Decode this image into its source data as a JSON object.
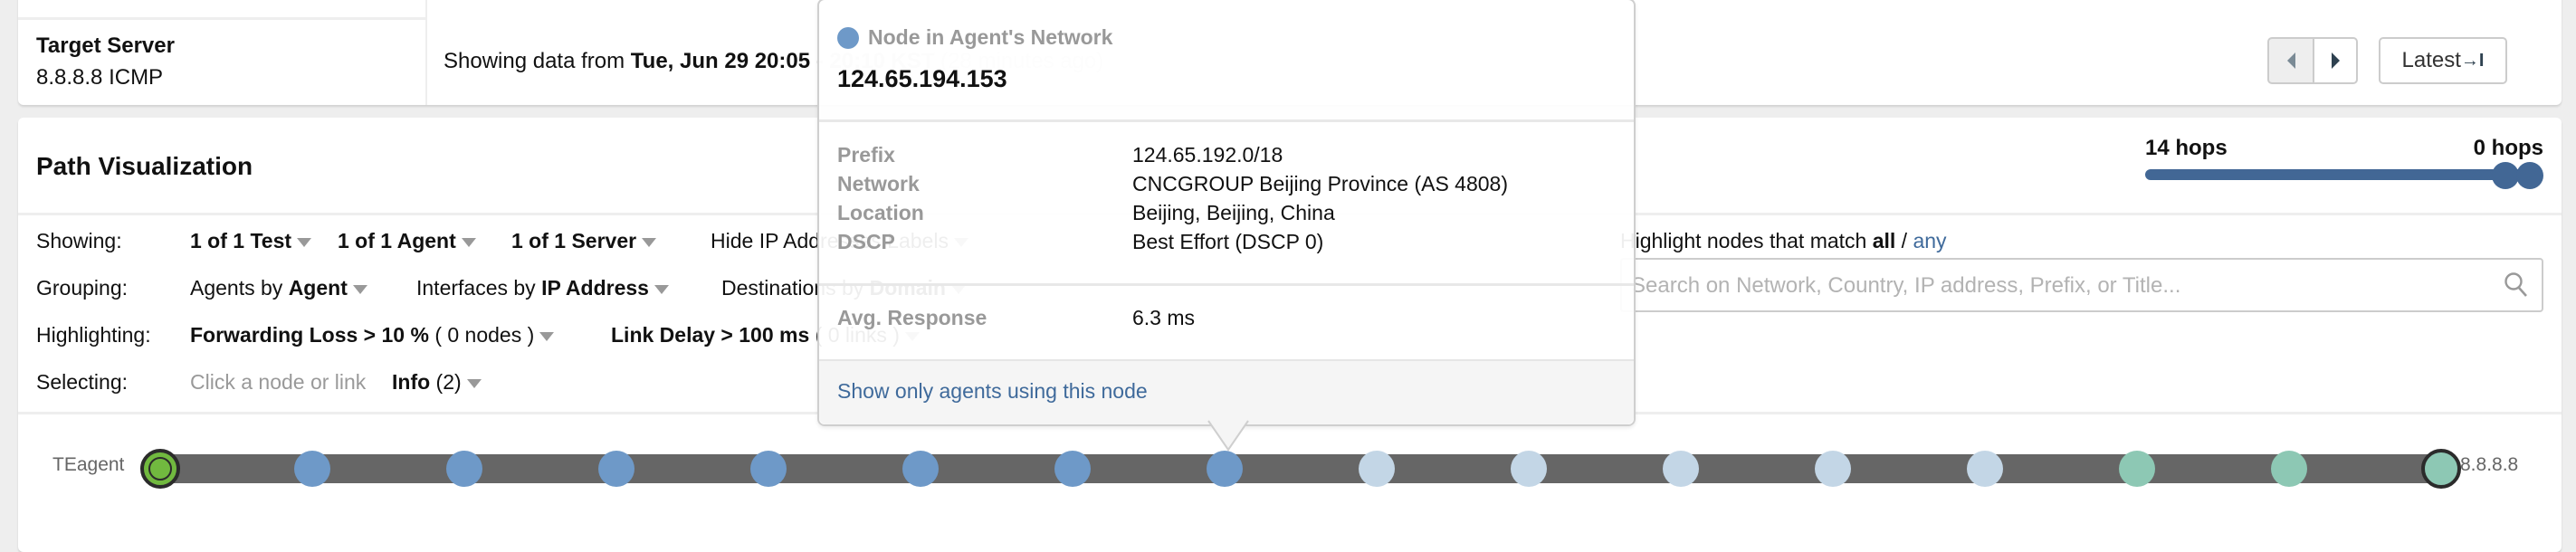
{
  "header": {
    "target_label": "Target Server",
    "target_value": "8.8.8.8 ICMP",
    "time_prefix": "Showing data from ",
    "time_start": "Tue, Jun 29 20:05",
    "time_end": " - 20:10 KST",
    "time_ago": " (28 minutes ago)",
    "prev_icon": "caret-left-icon",
    "next_icon": "caret-right-icon",
    "latest_label": "Latest",
    "latest_icon": "→I"
  },
  "path_viz": {
    "title": "Path Visualization",
    "hops_slider": {
      "left_label": "14 hops",
      "right_label": "0 hops",
      "min_hops": 0,
      "max_hops": 14,
      "range_low": 0,
      "range_high": 0
    },
    "controls": {
      "showing": {
        "label": "Showing:",
        "items": [
          "1 of 1 Test",
          "1 of 1 Agent",
          "1 of 1 Server"
        ],
        "hide_ip_prefix": "Hide IP Addresses",
        "hide_ip_suffix": " Labels"
      },
      "grouping": {
        "label": "Grouping:",
        "agents_pre": "Agents by ",
        "agents_val": "Agent",
        "interfaces_pre": "Interfaces by ",
        "interfaces_val": "IP Address",
        "dest_pre": "Destinations by ",
        "dest_val": "Domain"
      },
      "highlighting": {
        "label": "Highlighting:",
        "loss_val": "Forwarding Loss > 10 %",
        "loss_count": " ( 0 nodes )",
        "delay_val": "Link Delay > 100 ms",
        "delay_count": " ( 0 links )"
      },
      "selecting": {
        "label": "Selecting:",
        "hint": "Click a node or link",
        "info_val": "Info",
        "info_count": " (2)"
      },
      "match": {
        "prefix": "Highlight nodes that match ",
        "all": "all",
        "sep": " / ",
        "any": "any"
      },
      "search_placeholder": "Search on Network, Country, IP address, Prefix, or Title...",
      "search_value": ""
    },
    "path": {
      "source_label": "TEagent",
      "dest_label": "8.8.8.8",
      "nodes": [
        {
          "type": "agent",
          "color": "#71b93f"
        },
        {
          "type": "agent-network",
          "color": "#6e99c8"
        },
        {
          "type": "agent-network",
          "color": "#6e99c8"
        },
        {
          "type": "agent-network",
          "color": "#6e99c8"
        },
        {
          "type": "agent-network",
          "color": "#6e99c8"
        },
        {
          "type": "agent-network",
          "color": "#6e99c8"
        },
        {
          "type": "agent-network",
          "color": "#6e99c8"
        },
        {
          "type": "agent-network",
          "color": "#6e99c8",
          "selected": true
        },
        {
          "type": "transit",
          "color": "#c3d6e6"
        },
        {
          "type": "transit",
          "color": "#c3d6e6"
        },
        {
          "type": "transit",
          "color": "#c3d6e6"
        },
        {
          "type": "transit",
          "color": "#c3d6e6"
        },
        {
          "type": "transit",
          "color": "#c3d6e6"
        },
        {
          "type": "server-network",
          "color": "#8dc8b4"
        },
        {
          "type": "server-network",
          "color": "#8dc8b4"
        },
        {
          "type": "server",
          "color": "#8dc8b4"
        }
      ]
    }
  },
  "popup": {
    "category": "Node in Agent's Network",
    "category_color": "#6e99c8",
    "ip": "124.65.194.153",
    "details": [
      {
        "key": "Prefix",
        "value": "124.65.192.0/18"
      },
      {
        "key": "Network",
        "value": "CNCGROUP Beijing Province (AS 4808)"
      },
      {
        "key": "Location",
        "value": "Beijing, Beijing, China"
      },
      {
        "key": "DSCP",
        "value": "Best Effort (DSCP 0)"
      }
    ],
    "avg_response_label": "Avg. Response",
    "avg_response_value": "6.3 ms",
    "action_link": "Show only agents using this node"
  }
}
